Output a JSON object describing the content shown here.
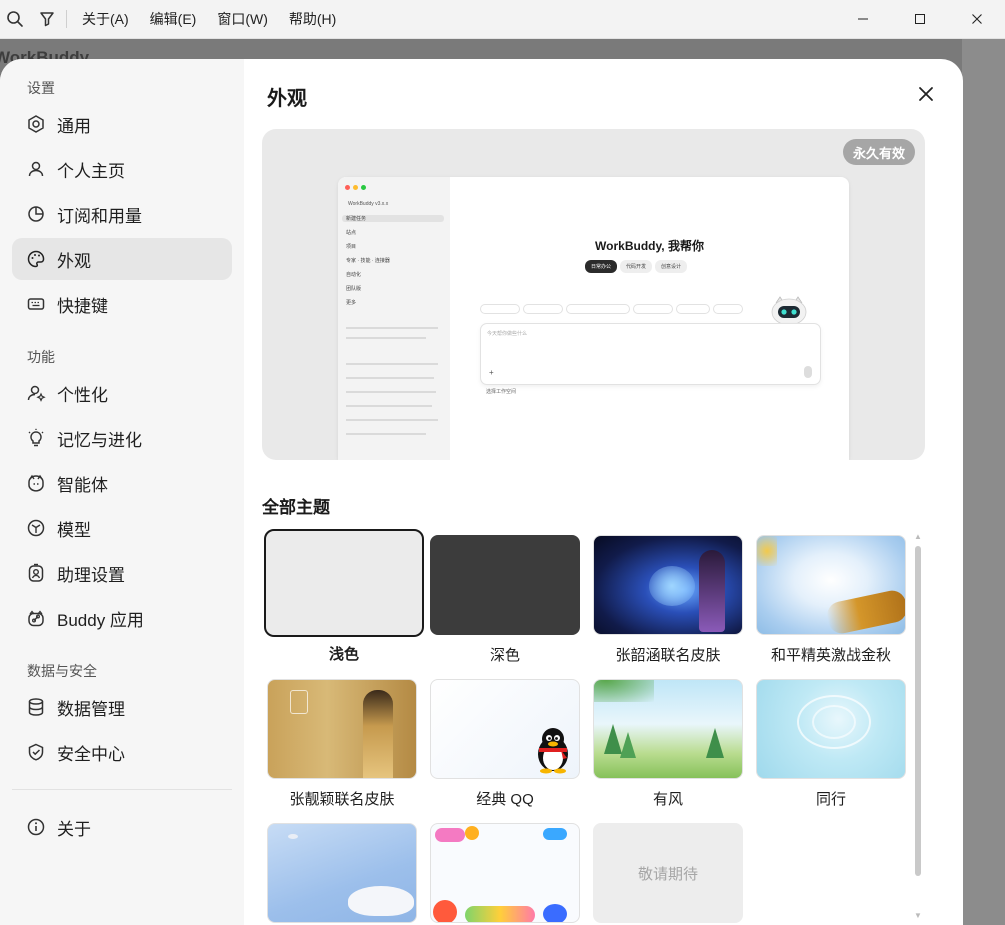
{
  "menubar": {
    "items": [
      "关于(A)",
      "编辑(E)",
      "窗口(W)",
      "帮助(H)"
    ]
  },
  "background_app": {
    "title": "WorkBuddy"
  },
  "sidebar": {
    "groups": [
      {
        "label": "设置",
        "items": [
          "通用",
          "个人主页",
          "订阅和用量",
          "外观",
          "快捷键"
        ]
      },
      {
        "label": "功能",
        "items": [
          "个性化",
          "记忆与进化",
          "智能体",
          "模型",
          "助理设置",
          "Buddy 应用"
        ]
      },
      {
        "label": "数据与安全",
        "items": [
          "数据管理",
          "安全中心"
        ]
      }
    ],
    "about": "关于",
    "active": "外观"
  },
  "content": {
    "title": "外观",
    "badge": "永久有效",
    "section_title": "全部主题"
  },
  "preview": {
    "brand": "WorkBuddy v3.x.x",
    "headline": "WorkBuddy, 我帮你",
    "tabs": [
      "日常办公",
      "代码开发",
      "创意设计"
    ],
    "placeholder": "今天帮你做些什么",
    "nav": [
      "新建任务",
      "站点",
      "项目",
      "专家 · 技能 · 连接器",
      "自动化",
      "团队版",
      "更多"
    ],
    "footer": "选择工作空间"
  },
  "themes": [
    {
      "name": "浅色",
      "selected": true
    },
    {
      "name": "深色",
      "selected": false
    },
    {
      "name": "张韶涵联名皮肤",
      "selected": false
    },
    {
      "name": "和平精英激战金秋",
      "selected": false
    },
    {
      "name": "张靓颖联名皮肤",
      "selected": false
    },
    {
      "name": "经典 QQ",
      "selected": false
    },
    {
      "name": "有风",
      "selected": false
    },
    {
      "name": "同行",
      "selected": false
    },
    {
      "name": "",
      "selected": false
    },
    {
      "name": "",
      "selected": false
    },
    {
      "name": "敬请期待",
      "selected": false
    }
  ],
  "colors": {
    "accent": "#1a1a1a",
    "sidebar_bg": "#f6f6f6",
    "active_item": "#e6e6e6",
    "badge": "#a6a6a6"
  }
}
